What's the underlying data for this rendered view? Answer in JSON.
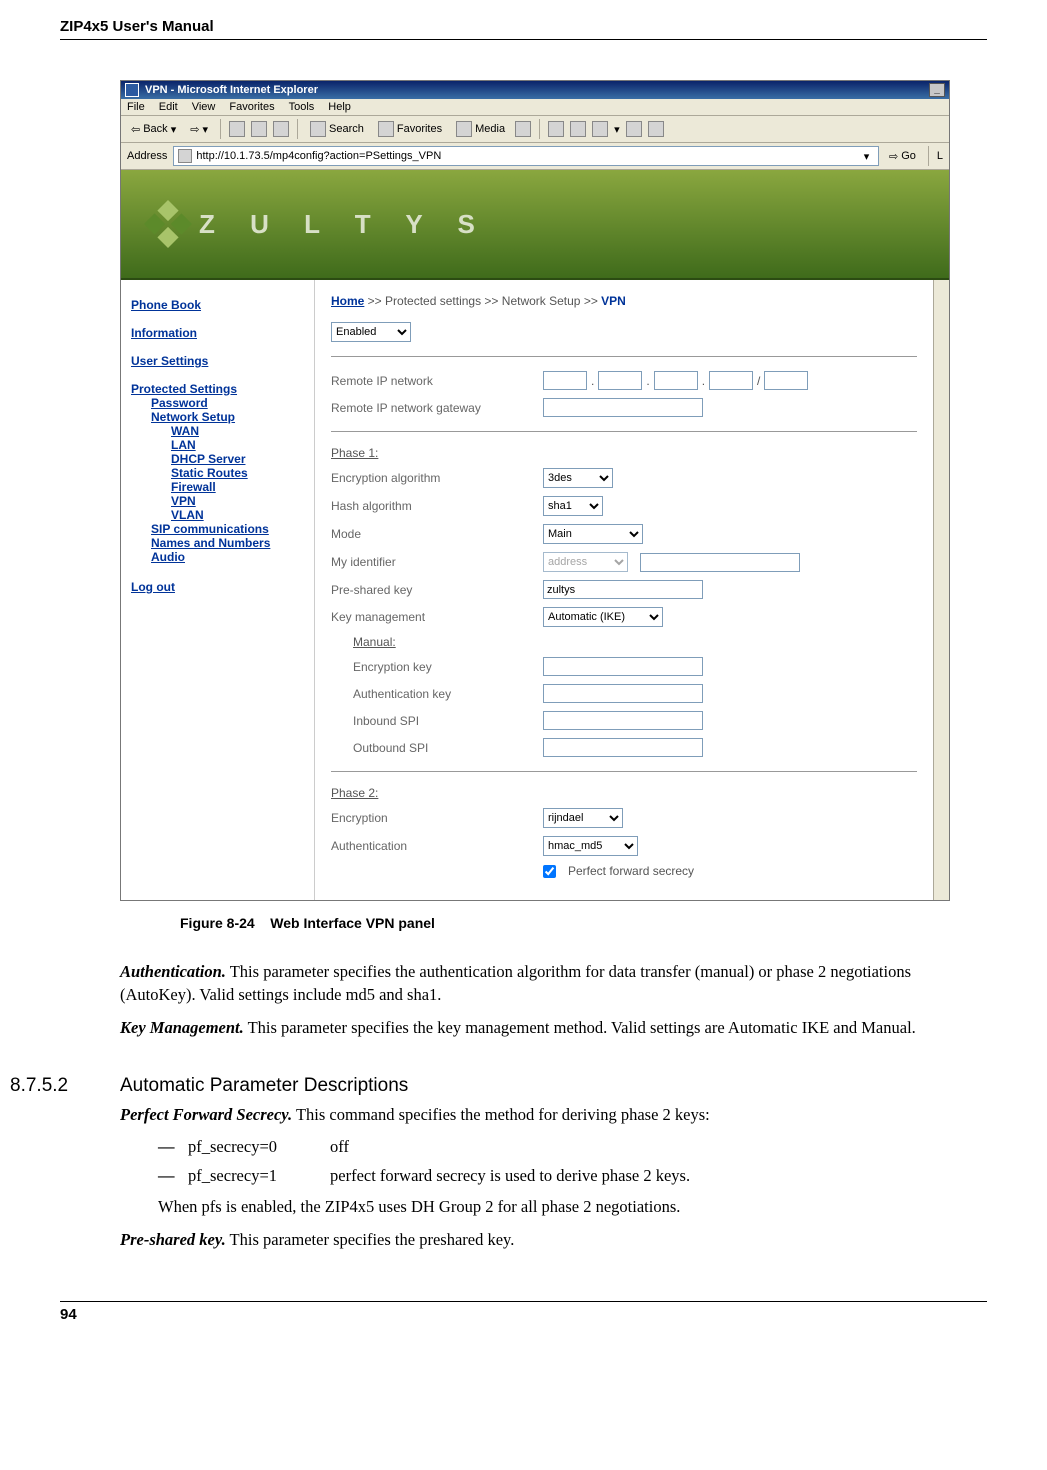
{
  "header": {
    "title": "ZIP4x5 User's Manual"
  },
  "footer": {
    "page": "94"
  },
  "ie": {
    "title": "VPN - Microsoft Internet Explorer",
    "menus": [
      "File",
      "Edit",
      "View",
      "Favorites",
      "Tools",
      "Help"
    ],
    "toolbar": {
      "back": "Back",
      "search": "Search",
      "favorites": "Favorites",
      "media": "Media"
    },
    "address_label": "Address",
    "address_value": "http://10.1.73.5/mp4config?action=PSettings_VPN",
    "go": "Go",
    "links": "L"
  },
  "logo_text": "Z U L T Y S",
  "sidebar": {
    "phone_book": "Phone Book",
    "information": "Information",
    "user_settings": "User Settings",
    "protected": "Protected Settings",
    "password": "Password",
    "network": "Network Setup",
    "wan": "WAN",
    "lan": "LAN",
    "dhcp": "DHCP Server",
    "static_routes": "Static Routes",
    "firewall": "Firewall",
    "vpn": "VPN",
    "vlan": "VLAN",
    "sip": "SIP communications",
    "names": "Names and Numbers",
    "audio": "Audio",
    "logout": "Log out"
  },
  "breadcrumb": {
    "home": "Home",
    "sep": " >> ",
    "p1": "Protected settings",
    "p2": "Network Setup",
    "cur": "VPN"
  },
  "form": {
    "enabled": "Enabled",
    "remote_ip": "Remote IP network",
    "remote_gw": "Remote IP network gateway",
    "slash": "/",
    "phase1": "Phase 1:",
    "enc_alg": "Encryption algorithm",
    "enc_alg_val": "3des",
    "hash_alg": "Hash algorithm",
    "hash_alg_val": "sha1",
    "mode": "Mode",
    "mode_val": "Main",
    "my_id": "My identifier",
    "my_id_val": "address",
    "psk": "Pre-shared key",
    "psk_val": "zultys",
    "key_mgmt": "Key management",
    "key_mgmt_val": "Automatic (IKE)",
    "manual": "Manual:",
    "enc_key": "Encryption key",
    "auth_key": "Authentication key",
    "in_spi": "Inbound SPI",
    "out_spi": "Outbound SPI",
    "phase2": "Phase 2:",
    "enc2": "Encryption",
    "enc2_val": "rijndael",
    "auth2": "Authentication",
    "auth2_val": "hmac_md5",
    "pfs": "Perfect forward secrecy"
  },
  "caption": {
    "label": "Figure 8-24",
    "text": "Web Interface VPN panel"
  },
  "body": {
    "auth_head": "Authentication.",
    "auth_text": " This parameter specifies the authentication algorithm for data transfer (manual) or phase 2 negotiations (AutoKey). Valid settings include md5 and sha1.",
    "km_head": "Key Management.",
    "km_text": " This parameter specifies the key management method. Valid settings are Automatic IKE and Manual.",
    "sec_num": "8.7.5.2",
    "sec_title": "Automatic Parameter Descriptions",
    "pfs_head": "Perfect Forward Secrecy.",
    "pfs_text": " This command specifies the method for deriving phase 2 keys:",
    "b1_key": "pf_secrecy=0",
    "b1_val": "off",
    "b2_key": "pf_secrecy=1",
    "b2_val": "perfect forward secrecy is used to derive phase 2 keys.",
    "pfs_tail": "When pfs is enabled, the ZIP4x5 uses DH Group 2 for all phase 2 negotiations.",
    "psk_head": "Pre-shared key.",
    "psk_text": " This parameter specifies the preshared key."
  }
}
